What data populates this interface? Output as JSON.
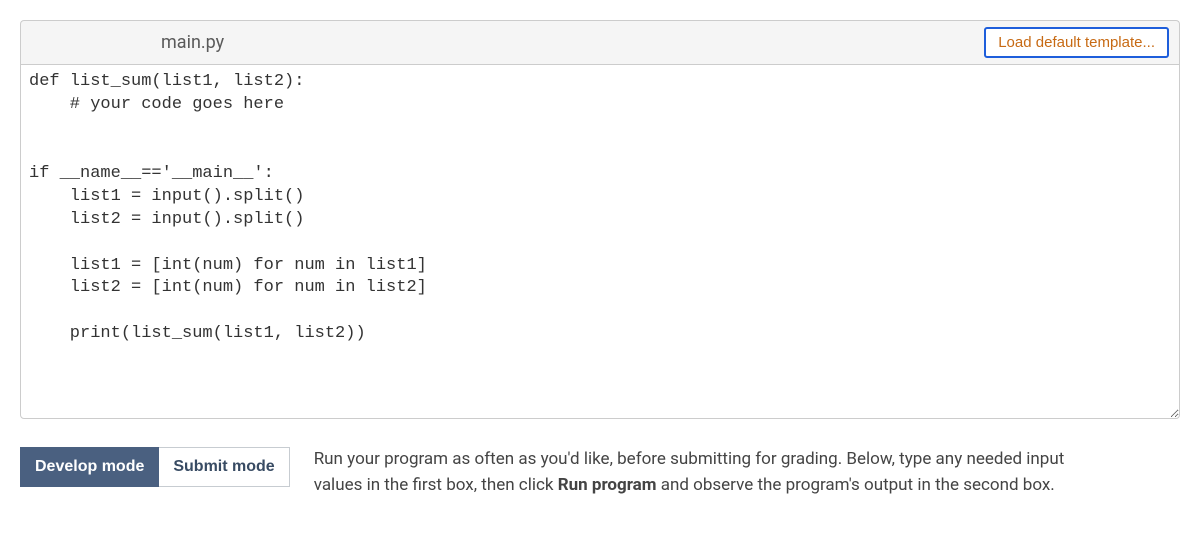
{
  "header": {
    "filename": "main.py",
    "load_template_label": "Load default template..."
  },
  "code": "def list_sum(list1, list2):\n    # your code goes here\n\n\nif __name__=='__main__':\n    list1 = input().split()\n    list2 = input().split()\n\n    list1 = [int(num) for num in list1]\n    list2 = [int(num) for num in list2]\n\n    print(list_sum(list1, list2))",
  "modes": {
    "develop_label": "Develop mode",
    "submit_label": "Submit mode"
  },
  "help": {
    "pre": "Run your program as often as you'd like, before submitting for grading. Below, type any needed input values in the first box, then click ",
    "bold": "Run program",
    "post": " and observe the program's output in the second box."
  }
}
